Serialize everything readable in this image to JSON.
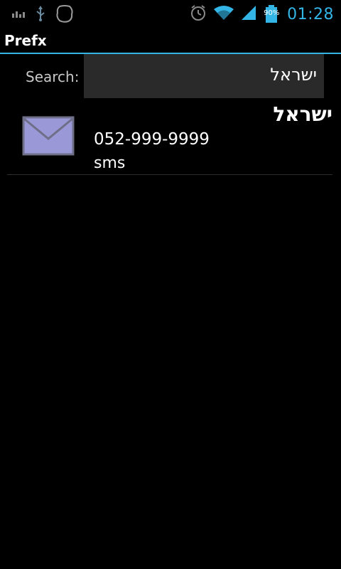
{
  "status_bar": {
    "left_icons": [
      "bar-chart-icon",
      "usb-icon",
      "app-notification-icon"
    ],
    "right_icons": [
      "alarm-icon",
      "wifi-icon",
      "signal-icon",
      "battery-icon"
    ],
    "battery_percent": "90%",
    "time": "01:28",
    "accent_color": "#33b5e5"
  },
  "app": {
    "title": "Prefx"
  },
  "search": {
    "label": "Search:",
    "value": "ישראל"
  },
  "results": [
    {
      "icon": "envelope-icon",
      "name": "ישראל",
      "number": "052-999-9999",
      "type": "sms"
    }
  ]
}
